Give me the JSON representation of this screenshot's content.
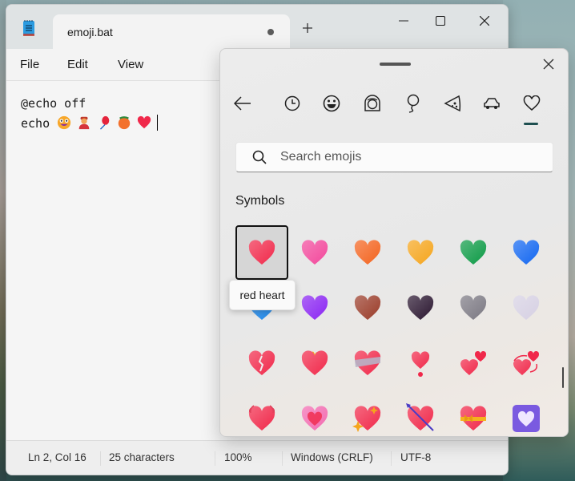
{
  "notepad": {
    "tab_title": "emoji.bat",
    "tab_unsaved": true,
    "menu": [
      "File",
      "Edit",
      "View"
    ],
    "editor_lines": [
      {
        "text": "@echo off",
        "emojis": []
      },
      {
        "text": "echo ",
        "emojis": [
          "zany-face",
          "person-with-cap",
          "balloon",
          "peach",
          "red-heart"
        ]
      }
    ],
    "status": {
      "position": "Ln 2, Col 16",
      "characters": "25 characters",
      "zoom": "100%",
      "line_ending": "Windows (CRLF)",
      "encoding": "UTF-8"
    }
  },
  "emoji_picker": {
    "categories": [
      {
        "name": "back",
        "icon": "back-arrow-icon"
      },
      {
        "name": "recent",
        "icon": "clock-icon"
      },
      {
        "name": "smileys",
        "icon": "smiley-icon"
      },
      {
        "name": "people",
        "icon": "person-face-icon"
      },
      {
        "name": "celebration",
        "icon": "balloon-icon"
      },
      {
        "name": "food",
        "icon": "pizza-icon"
      },
      {
        "name": "travel",
        "icon": "car-icon"
      },
      {
        "name": "symbols",
        "icon": "heart-icon",
        "active": true
      }
    ],
    "search_placeholder": "Search emojis",
    "section_label": "Symbols",
    "tooltip": "red heart",
    "selected_index": 0,
    "emojis": [
      {
        "name": "red heart",
        "color": "#f0284a"
      },
      {
        "name": "pink heart",
        "color": "#f2479b"
      },
      {
        "name": "orange heart",
        "color": "#f3631e"
      },
      {
        "name": "yellow heart",
        "color": "#f5a51c"
      },
      {
        "name": "green heart",
        "color": "#0c9a45"
      },
      {
        "name": "blue heart",
        "color": "#1266f0"
      },
      {
        "name": "light blue heart",
        "color": "#1d86e8"
      },
      {
        "name": "purple heart",
        "color": "#8a24f2"
      },
      {
        "name": "brown heart",
        "color": "#9a3b28"
      },
      {
        "name": "black heart",
        "color": "#2a1630"
      },
      {
        "name": "grey heart",
        "color": "#7b7882"
      },
      {
        "name": "white heart",
        "color": "#d6d0e3"
      },
      {
        "name": "broken heart",
        "color": "#f0284a"
      },
      {
        "name": "heart on fire",
        "color": "#f0284a"
      },
      {
        "name": "mending heart",
        "color": "#f0284a"
      },
      {
        "name": "heart exclamation",
        "color": "#f0284a"
      },
      {
        "name": "two hearts",
        "color": "#f0284a"
      },
      {
        "name": "revolving hearts",
        "color": "#f0284a"
      },
      {
        "name": "beating heart",
        "color": "#f0284a"
      },
      {
        "name": "growing heart",
        "color": "#f26ab0"
      },
      {
        "name": "sparkling heart",
        "color": "#f0284a"
      },
      {
        "name": "heart with arrow",
        "color": "#f0284a"
      },
      {
        "name": "heart with ribbon",
        "color": "#f0284a"
      },
      {
        "name": "heart decoration",
        "color": "#7a5ae0"
      }
    ]
  }
}
